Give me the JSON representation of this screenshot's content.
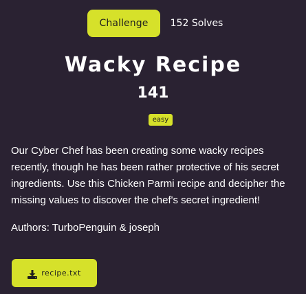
{
  "tabs": {
    "challenge_label": "Challenge",
    "solves_label": "152 Solves"
  },
  "challenge": {
    "title": "Wacky Recipe",
    "points": "141",
    "difficulty": "easy",
    "description": "Our Cyber Chef has been creating some wacky recipes recently, though he has been rather protective of his secret ingredients. Use this Chicken Parmi recipe and decipher the missing values to discover the chef's secret ingredient!",
    "authors": "Authors: TurboPenguin & joseph"
  },
  "files": {
    "download_label": "recipe.txt",
    "icon": "download-icon"
  },
  "colors": {
    "background": "#2a2232",
    "accent": "#d6e12a",
    "text": "#ffffff"
  }
}
